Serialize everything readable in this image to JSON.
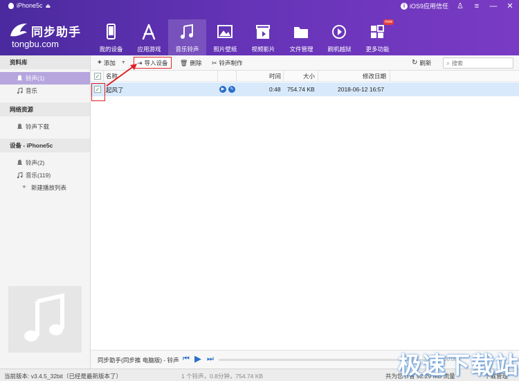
{
  "window": {
    "device_name": "iPhone5c",
    "trust_link": "iOS9应用信任",
    "minimize": "—",
    "close": "✕"
  },
  "brand": {
    "name": "同步助手",
    "url": "tongbu.com",
    "color": "#6433b6"
  },
  "nav": {
    "items": [
      {
        "label": "我的设备",
        "icon": "phone-icon"
      },
      {
        "label": "应用游戏",
        "icon": "app-store-icon"
      },
      {
        "label": "音乐铃声",
        "icon": "music-note-icon",
        "active": true
      },
      {
        "label": "照片壁纸",
        "icon": "photo-icon"
      },
      {
        "label": "视频影片",
        "icon": "clapper-icon"
      },
      {
        "label": "文件管理",
        "icon": "folder-icon"
      },
      {
        "label": "刷机越狱",
        "icon": "flash-icon"
      },
      {
        "label": "更多功能",
        "icon": "more-grid-icon",
        "badge": "new"
      }
    ]
  },
  "sidebar": {
    "library_title": "资料库",
    "library_items": [
      {
        "label": "铃声(1)",
        "active": true
      },
      {
        "label": "音乐"
      }
    ],
    "web_title": "网络资源",
    "web_items": [
      {
        "label": "铃声下载"
      }
    ],
    "device_title": "设备 - iPhone5c",
    "device_items": [
      {
        "label": "铃声(2)"
      },
      {
        "label": "音乐(119)"
      },
      {
        "label": "新建播放列表"
      }
    ]
  },
  "toolbar": {
    "add": "添加",
    "import": "导入设备",
    "delete": "删除",
    "ringtone_maker": "铃声制作",
    "refresh": "刷新",
    "search_placeholder": "搜索"
  },
  "table": {
    "columns": {
      "name": "名称",
      "time": "时间",
      "size": "大小",
      "date": "修改日期"
    },
    "rows": [
      {
        "name": "起风了",
        "time": "0:48",
        "size": "754.74 KB",
        "date": "2018-06-12 16:57",
        "checked": true
      }
    ]
  },
  "player": {
    "title": "同步助手(同步推 电脑版) - 铃声",
    "time": "00:00"
  },
  "status": {
    "version": "当前版本: v3.4.5_32bit（已经是最新版本了）",
    "summary": "1 个铃声，0.8分钟，754.74 KB",
    "saved": "共为您节省 92.29 MB 流量",
    "downloads": "下载管理"
  },
  "watermark": "极速下载站"
}
